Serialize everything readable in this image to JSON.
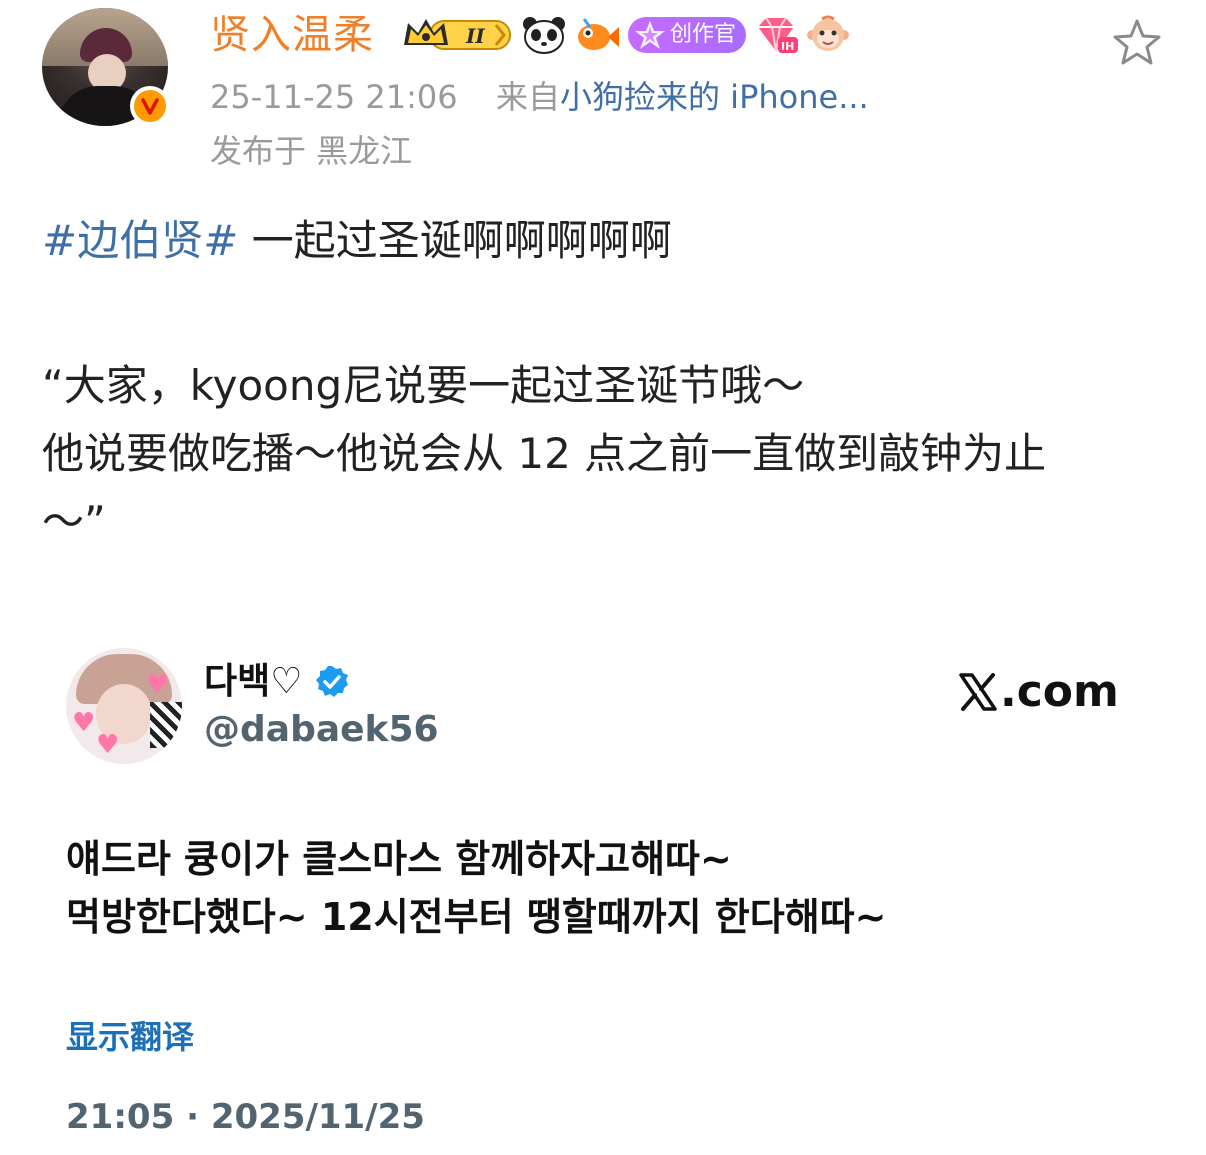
{
  "post": {
    "username": "贤入温柔",
    "badge_level": "II",
    "creator_badge": "创作官",
    "diamond_badge": "IH",
    "timestamp": "25-11-25 21:06",
    "source_prefix": "来自",
    "source": "小狗捡来的 iPhone...",
    "location": "发布于 黑龙江",
    "hashtag": "#边伯贤#",
    "text_line1": " 一起过圣诞啊啊啊啊啊",
    "quote_lines": [
      "“大家，kyoong尼说要一起过圣诞节哦～",
      "他说要做吃播～他说会从 12 点之前一直做到敲钟为止",
      "～”"
    ]
  },
  "tweet": {
    "display_name": "다백♡",
    "handle": "@dabaek56",
    "site": ".com",
    "text_lines": [
      "얘드라 큥이가 클스마스 함께하자고해따~",
      "먹방한다했다~ 12시전부터 땡할때까지 한다해따~"
    ],
    "translate_label": "显示翻译",
    "time": "21:05 · 2025/11/25"
  },
  "colors": {
    "username": "#f07f29",
    "link": "#3f6fa8",
    "meta": "#9a9a9a",
    "verified": "#1d9bf0",
    "translate": "#1d6fb8"
  },
  "icons": {
    "star": "star-icon",
    "verified": "verified-check-icon",
    "x_logo": "x-logo-icon",
    "v_badge": "weibo-v-badge-icon"
  }
}
